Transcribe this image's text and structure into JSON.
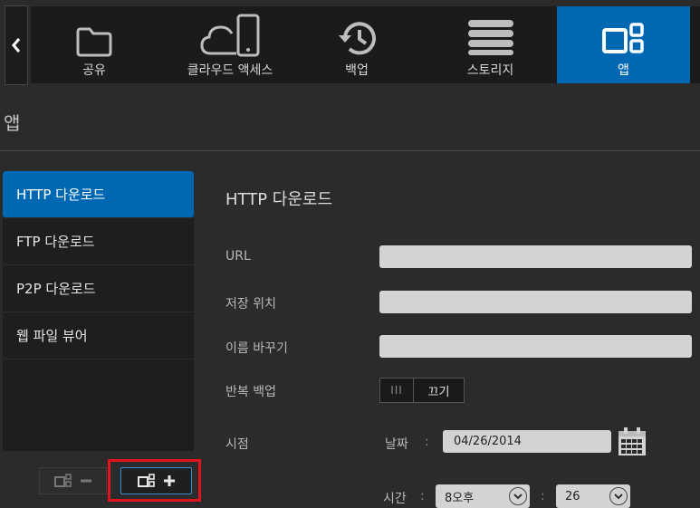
{
  "nav": {
    "items": [
      {
        "label": "공유",
        "icon": "folder-icon"
      },
      {
        "label": "클라우드 액세스",
        "icon": "cloud-phone-icon"
      },
      {
        "label": "백업",
        "icon": "history-icon"
      },
      {
        "label": "스토리지",
        "icon": "storage-stack-icon"
      },
      {
        "label": "앱",
        "icon": "apps-icon",
        "active": true
      }
    ]
  },
  "page": {
    "title": "앱"
  },
  "sidebar": {
    "items": [
      {
        "label": "HTTP 다운로드",
        "active": true
      },
      {
        "label": "FTP 다운로드"
      },
      {
        "label": "P2P 다운로드"
      },
      {
        "label": "웹 파일 뷰어"
      }
    ]
  },
  "content": {
    "title": "HTTP 다운로드",
    "url_label": "URL",
    "url_value": "",
    "save_label": "저장 위치",
    "save_value": "",
    "rename_label": "이름 바꾸기",
    "rename_value": "",
    "repeat_label": "반복 백업",
    "repeat_on": "III",
    "repeat_off": "끄기",
    "schedule_label": "시점",
    "date_label": "날짜",
    "date_value": "04/26/2014",
    "time_label": "시간",
    "hour_value": "8오후",
    "minute_value": "26"
  },
  "colors": {
    "accent": "#0068b2",
    "highlight": "#e0141e"
  }
}
